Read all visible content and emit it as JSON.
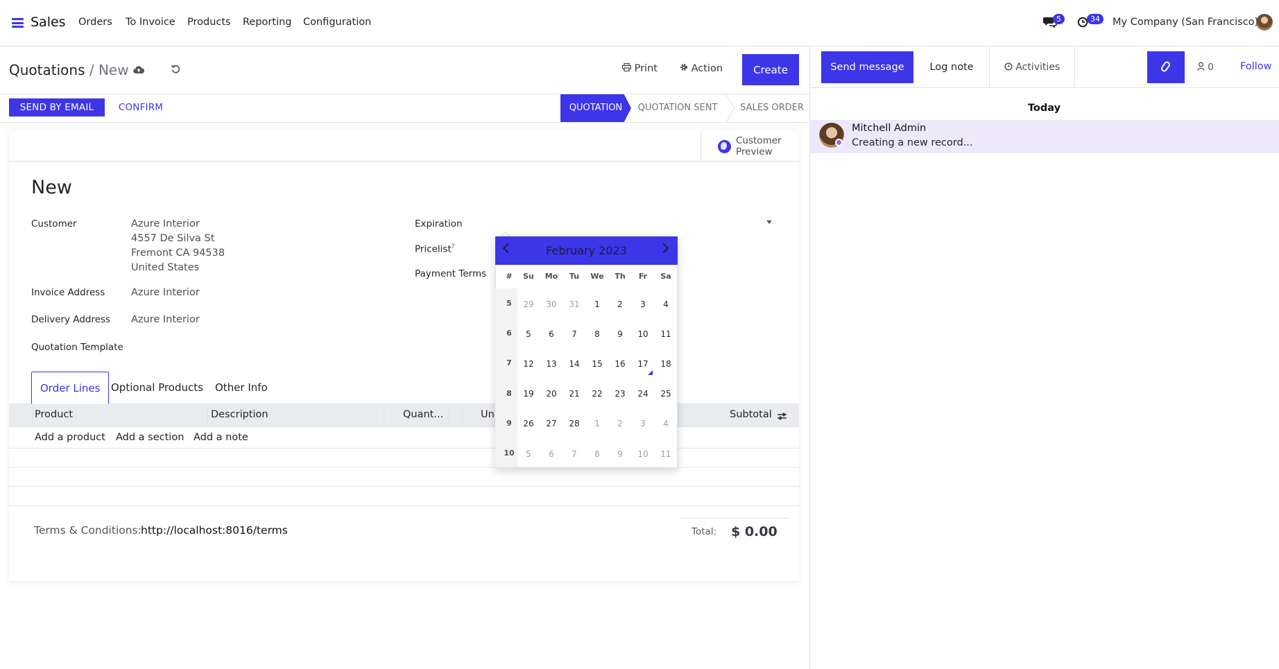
{
  "navbar": {
    "app_name": "Sales",
    "menu": [
      "Orders",
      "To Invoice",
      "Products",
      "Reporting",
      "Configuration"
    ],
    "messages_badge": "5",
    "activities_badge": "34",
    "company": "My Company (San Francisco)"
  },
  "control_panel": {
    "breadcrumb_root": "Quotations",
    "breadcrumb_sep": "/",
    "breadcrumb_current": "New",
    "print_label": "Print",
    "action_label": "Action",
    "create_label": "Create"
  },
  "statusbar": {
    "send_email_label": "SEND BY EMAIL",
    "confirm_label": "CONFIRM",
    "stages": [
      "QUOTATION",
      "QUOTATION SENT",
      "SALES ORDER"
    ],
    "active_stage": "QUOTATION"
  },
  "button_box": {
    "customer_preview_line1": "Customer",
    "customer_preview_line2": "Preview"
  },
  "form": {
    "record_name": "New",
    "customer_label": "Customer",
    "customer_name": "Azure Interior",
    "customer_street": "4557 De Silva St",
    "customer_city": "Fremont CA 94538",
    "customer_country": "United States",
    "invoice_address_label": "Invoice Address",
    "invoice_address_value": "Azure Interior",
    "delivery_address_label": "Delivery Address",
    "delivery_address_value": "Azure Interior",
    "quotation_template_label": "Quotation Template",
    "expiration_label": "Expiration",
    "pricelist_label": "Pricelist",
    "pricelist_help": "?",
    "payment_terms_label": "Payment Terms"
  },
  "notebook": {
    "tabs": [
      "Order Lines",
      "Optional Products",
      "Other Info"
    ],
    "active_tab": "Order Lines",
    "columns": [
      "Product",
      "Description",
      "Quant...",
      "Un",
      "Subtotal"
    ],
    "add_links": [
      "Add a product",
      "Add a section",
      "Add a note"
    ]
  },
  "footer": {
    "terms_label": "Terms & Conditions:",
    "terms_value": "http://localhost:8016/terms",
    "total_label": "Total:",
    "total_value": "$ 0.00"
  },
  "datepicker": {
    "month_title": "February 2023",
    "week_header": "#",
    "days_of_week": [
      "Su",
      "Mo",
      "Tu",
      "We",
      "Th",
      "Fr",
      "Sa"
    ],
    "weeks": [
      {
        "week": "5",
        "days": [
          {
            "d": "29",
            "muted": true
          },
          {
            "d": "30",
            "muted": true
          },
          {
            "d": "31",
            "muted": true
          },
          {
            "d": "1"
          },
          {
            "d": "2"
          },
          {
            "d": "3"
          },
          {
            "d": "4"
          }
        ]
      },
      {
        "week": "6",
        "days": [
          {
            "d": "5"
          },
          {
            "d": "6"
          },
          {
            "d": "7"
          },
          {
            "d": "8"
          },
          {
            "d": "9"
          },
          {
            "d": "10"
          },
          {
            "d": "11"
          }
        ]
      },
      {
        "week": "7",
        "days": [
          {
            "d": "12"
          },
          {
            "d": "13"
          },
          {
            "d": "14"
          },
          {
            "d": "15"
          },
          {
            "d": "16"
          },
          {
            "d": "17"
          },
          {
            "d": "18"
          }
        ]
      },
      {
        "week": "8",
        "days": [
          {
            "d": "19"
          },
          {
            "d": "20"
          },
          {
            "d": "21"
          },
          {
            "d": "22"
          },
          {
            "d": "23"
          },
          {
            "d": "24"
          },
          {
            "d": "25"
          }
        ]
      },
      {
        "week": "9",
        "days": [
          {
            "d": "26"
          },
          {
            "d": "27"
          },
          {
            "d": "28"
          },
          {
            "d": "1",
            "muted": true
          },
          {
            "d": "2",
            "muted": true
          },
          {
            "d": "3",
            "muted": true
          },
          {
            "d": "4",
            "muted": true
          }
        ]
      },
      {
        "week": "10",
        "days": [
          {
            "d": "5",
            "muted": true
          },
          {
            "d": "6",
            "muted": true
          },
          {
            "d": "7",
            "muted": true
          },
          {
            "d": "8",
            "muted": true
          },
          {
            "d": "9",
            "muted": true
          },
          {
            "d": "10",
            "muted": true
          },
          {
            "d": "11",
            "muted": true
          }
        ]
      }
    ],
    "today": "17"
  },
  "chatter": {
    "send_message_label": "Send message",
    "log_note_label": "Log note",
    "activities_label": "Activities",
    "followers_count": "0",
    "follow_label": "Follow",
    "today_label": "Today",
    "message_author": "Mitchell Admin",
    "message_body": "Creating a new record..."
  },
  "colors": {
    "accent": "#3d35e8",
    "message_bg": "#ede9fb"
  }
}
